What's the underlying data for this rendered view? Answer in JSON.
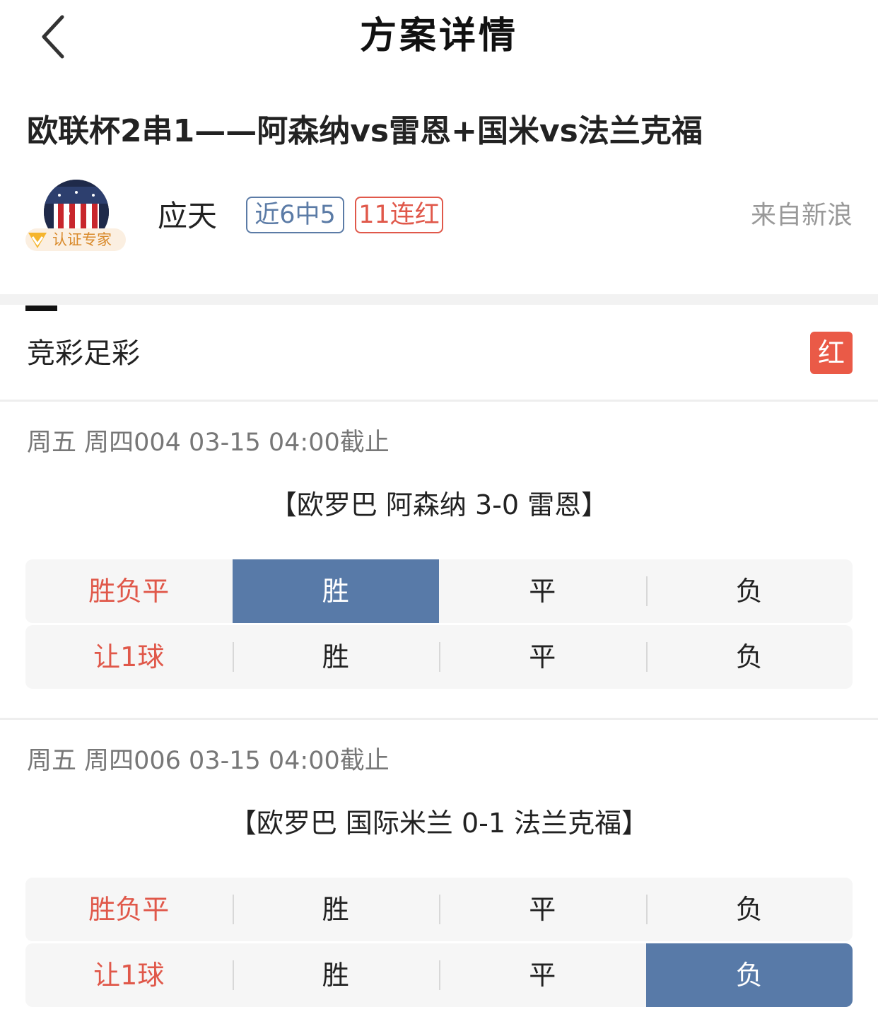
{
  "header": {
    "title": "方案详情",
    "back_icon": "chevron-left-icon"
  },
  "plan": {
    "title": "欧联杯2串1——阿森纳vs雷恩+国米vs法兰克福"
  },
  "author": {
    "name": "应天",
    "verified_label": "认证专家",
    "tags": [
      "近6中5",
      "11连红"
    ],
    "source": "来自新浪"
  },
  "lottery": {
    "type": "竞彩足彩",
    "result": "红"
  },
  "matches": [
    {
      "meta": "周五 周四004 03-15 04:00截止",
      "line": "【欧罗巴 阿森纳 3-0 雷恩】",
      "rows": [
        {
          "label": "胜负平",
          "options": [
            "胜",
            "平",
            "负"
          ],
          "selected": 0
        },
        {
          "label": "让1球",
          "options": [
            "胜",
            "平",
            "负"
          ],
          "selected": -1
        }
      ]
    },
    {
      "meta": "周五 周四006 03-15 04:00截止",
      "line": "【欧罗巴 国际米兰 0-1 法兰克福】",
      "rows": [
        {
          "label": "胜负平",
          "options": [
            "胜",
            "平",
            "负"
          ],
          "selected": -1
        },
        {
          "label": "让1球",
          "options": [
            "胜",
            "平",
            "负"
          ],
          "selected": 2
        }
      ]
    }
  ],
  "colors": {
    "accent_red": "#e0584a",
    "accent_blue": "#5b7ba6",
    "selected_bg": "#587aa8",
    "badge_red": "#ea5a47"
  }
}
